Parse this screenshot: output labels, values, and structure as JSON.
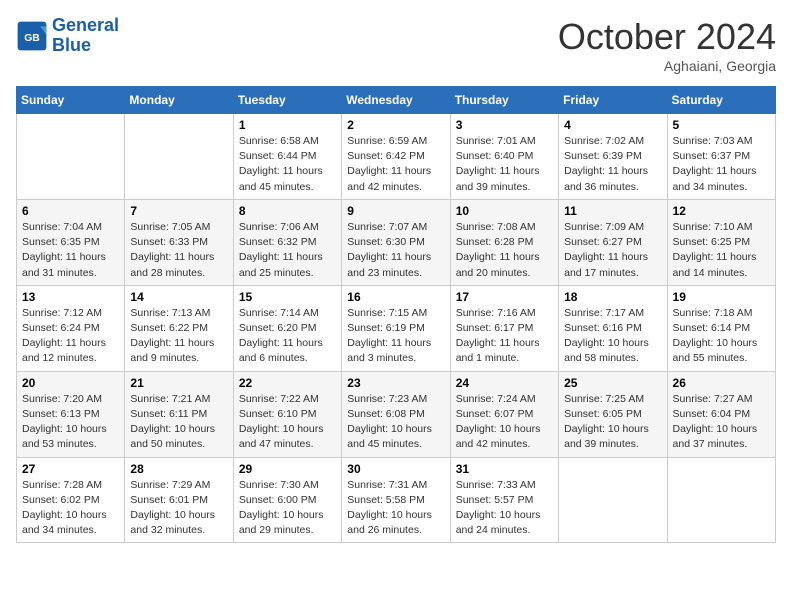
{
  "header": {
    "logo_general": "General",
    "logo_blue": "Blue",
    "month_title": "October 2024",
    "location": "Aghaiani, Georgia"
  },
  "weekdays": [
    "Sunday",
    "Monday",
    "Tuesday",
    "Wednesday",
    "Thursday",
    "Friday",
    "Saturday"
  ],
  "weeks": [
    [
      {
        "day": "",
        "info": ""
      },
      {
        "day": "",
        "info": ""
      },
      {
        "day": "1",
        "info": "Sunrise: 6:58 AM\nSunset: 6:44 PM\nDaylight: 11 hours and 45 minutes."
      },
      {
        "day": "2",
        "info": "Sunrise: 6:59 AM\nSunset: 6:42 PM\nDaylight: 11 hours and 42 minutes."
      },
      {
        "day": "3",
        "info": "Sunrise: 7:01 AM\nSunset: 6:40 PM\nDaylight: 11 hours and 39 minutes."
      },
      {
        "day": "4",
        "info": "Sunrise: 7:02 AM\nSunset: 6:39 PM\nDaylight: 11 hours and 36 minutes."
      },
      {
        "day": "5",
        "info": "Sunrise: 7:03 AM\nSunset: 6:37 PM\nDaylight: 11 hours and 34 minutes."
      }
    ],
    [
      {
        "day": "6",
        "info": "Sunrise: 7:04 AM\nSunset: 6:35 PM\nDaylight: 11 hours and 31 minutes."
      },
      {
        "day": "7",
        "info": "Sunrise: 7:05 AM\nSunset: 6:33 PM\nDaylight: 11 hours and 28 minutes."
      },
      {
        "day": "8",
        "info": "Sunrise: 7:06 AM\nSunset: 6:32 PM\nDaylight: 11 hours and 25 minutes."
      },
      {
        "day": "9",
        "info": "Sunrise: 7:07 AM\nSunset: 6:30 PM\nDaylight: 11 hours and 23 minutes."
      },
      {
        "day": "10",
        "info": "Sunrise: 7:08 AM\nSunset: 6:28 PM\nDaylight: 11 hours and 20 minutes."
      },
      {
        "day": "11",
        "info": "Sunrise: 7:09 AM\nSunset: 6:27 PM\nDaylight: 11 hours and 17 minutes."
      },
      {
        "day": "12",
        "info": "Sunrise: 7:10 AM\nSunset: 6:25 PM\nDaylight: 11 hours and 14 minutes."
      }
    ],
    [
      {
        "day": "13",
        "info": "Sunrise: 7:12 AM\nSunset: 6:24 PM\nDaylight: 11 hours and 12 minutes."
      },
      {
        "day": "14",
        "info": "Sunrise: 7:13 AM\nSunset: 6:22 PM\nDaylight: 11 hours and 9 minutes."
      },
      {
        "day": "15",
        "info": "Sunrise: 7:14 AM\nSunset: 6:20 PM\nDaylight: 11 hours and 6 minutes."
      },
      {
        "day": "16",
        "info": "Sunrise: 7:15 AM\nSunset: 6:19 PM\nDaylight: 11 hours and 3 minutes."
      },
      {
        "day": "17",
        "info": "Sunrise: 7:16 AM\nSunset: 6:17 PM\nDaylight: 11 hours and 1 minute."
      },
      {
        "day": "18",
        "info": "Sunrise: 7:17 AM\nSunset: 6:16 PM\nDaylight: 10 hours and 58 minutes."
      },
      {
        "day": "19",
        "info": "Sunrise: 7:18 AM\nSunset: 6:14 PM\nDaylight: 10 hours and 55 minutes."
      }
    ],
    [
      {
        "day": "20",
        "info": "Sunrise: 7:20 AM\nSunset: 6:13 PM\nDaylight: 10 hours and 53 minutes."
      },
      {
        "day": "21",
        "info": "Sunrise: 7:21 AM\nSunset: 6:11 PM\nDaylight: 10 hours and 50 minutes."
      },
      {
        "day": "22",
        "info": "Sunrise: 7:22 AM\nSunset: 6:10 PM\nDaylight: 10 hours and 47 minutes."
      },
      {
        "day": "23",
        "info": "Sunrise: 7:23 AM\nSunset: 6:08 PM\nDaylight: 10 hours and 45 minutes."
      },
      {
        "day": "24",
        "info": "Sunrise: 7:24 AM\nSunset: 6:07 PM\nDaylight: 10 hours and 42 minutes."
      },
      {
        "day": "25",
        "info": "Sunrise: 7:25 AM\nSunset: 6:05 PM\nDaylight: 10 hours and 39 minutes."
      },
      {
        "day": "26",
        "info": "Sunrise: 7:27 AM\nSunset: 6:04 PM\nDaylight: 10 hours and 37 minutes."
      }
    ],
    [
      {
        "day": "27",
        "info": "Sunrise: 7:28 AM\nSunset: 6:02 PM\nDaylight: 10 hours and 34 minutes."
      },
      {
        "day": "28",
        "info": "Sunrise: 7:29 AM\nSunset: 6:01 PM\nDaylight: 10 hours and 32 minutes."
      },
      {
        "day": "29",
        "info": "Sunrise: 7:30 AM\nSunset: 6:00 PM\nDaylight: 10 hours and 29 minutes."
      },
      {
        "day": "30",
        "info": "Sunrise: 7:31 AM\nSunset: 5:58 PM\nDaylight: 10 hours and 26 minutes."
      },
      {
        "day": "31",
        "info": "Sunrise: 7:33 AM\nSunset: 5:57 PM\nDaylight: 10 hours and 24 minutes."
      },
      {
        "day": "",
        "info": ""
      },
      {
        "day": "",
        "info": ""
      }
    ]
  ]
}
